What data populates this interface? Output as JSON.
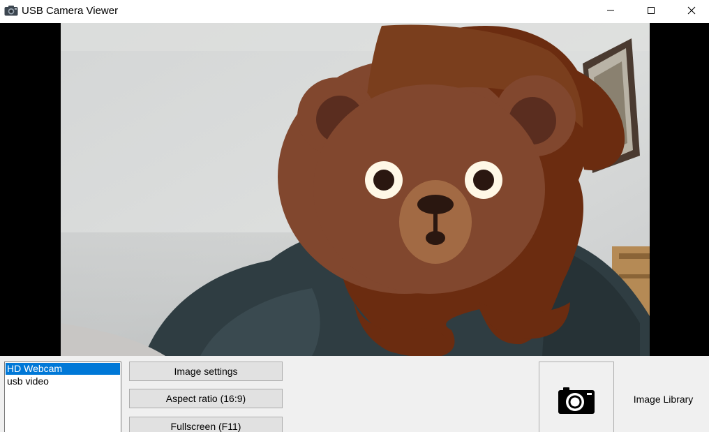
{
  "window": {
    "title": "USB Camera Viewer",
    "icons": {
      "app": "camera-icon",
      "minimize": "minimize-icon",
      "maximize": "maximize-icon",
      "close": "close-icon"
    }
  },
  "video": {
    "overlay": "bear-face-filter",
    "background_color": "#000000"
  },
  "cameras": {
    "items": [
      "HD Webcam",
      "usb video"
    ],
    "selected": "HD Webcam",
    "selected_color": "#0078d7"
  },
  "buttons": {
    "image_settings": "Image settings",
    "aspect_ratio": "Aspect ratio (16:9)",
    "fullscreen": "Fullscreen (F11)"
  },
  "capture": {
    "icon": "camera-icon"
  },
  "library": {
    "label": "Image Library"
  }
}
